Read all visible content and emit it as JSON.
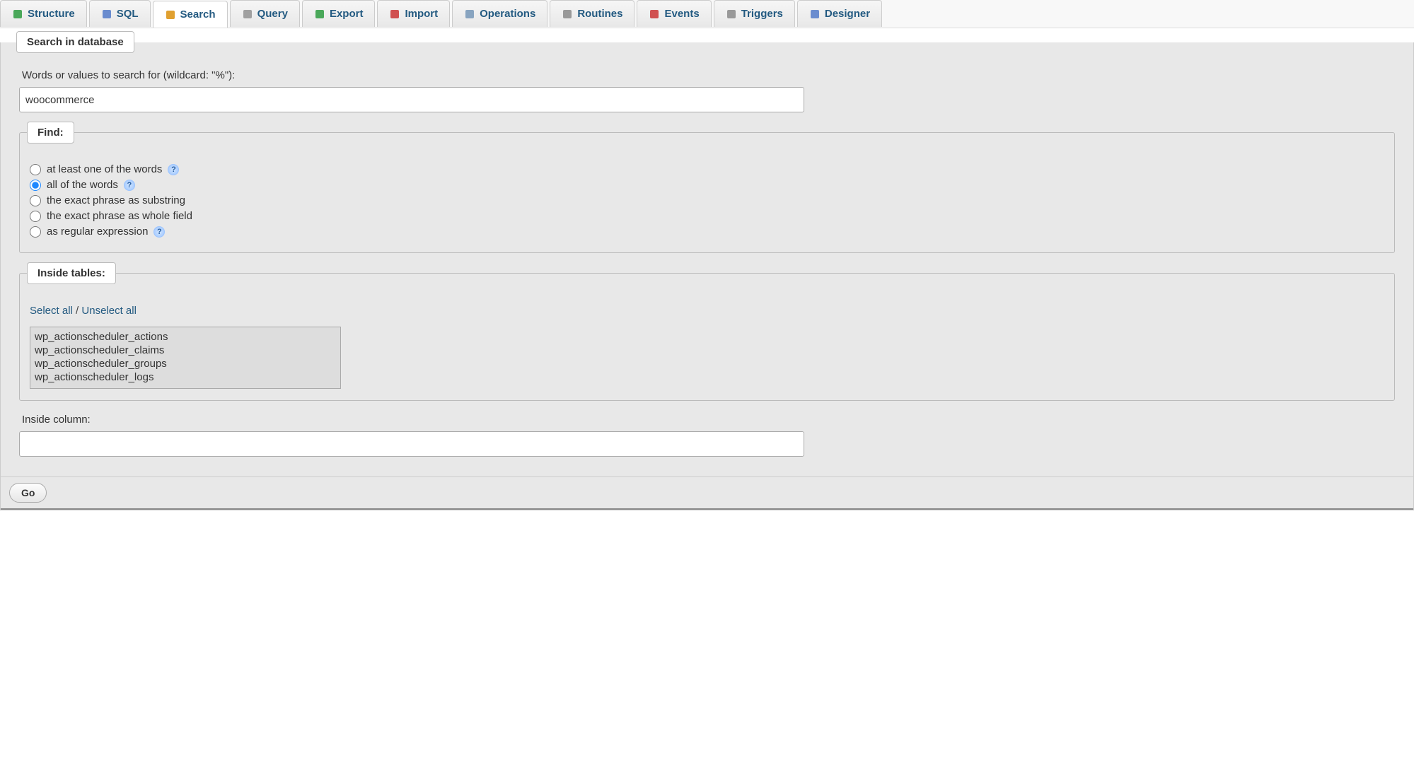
{
  "tabs": [
    {
      "label": "Structure",
      "icon": "structure-icon",
      "color": "#4aa85a"
    },
    {
      "label": "SQL",
      "icon": "sql-icon",
      "color": "#6a8ccf"
    },
    {
      "label": "Search",
      "icon": "search-icon",
      "color": "#e0a030",
      "active": true
    },
    {
      "label": "Query",
      "icon": "query-icon",
      "color": "#a0a0a0"
    },
    {
      "label": "Export",
      "icon": "export-icon",
      "color": "#4aa85a"
    },
    {
      "label": "Import",
      "icon": "import-icon",
      "color": "#d05050"
    },
    {
      "label": "Operations",
      "icon": "operations-icon",
      "color": "#88a4c0"
    },
    {
      "label": "Routines",
      "icon": "routines-icon",
      "color": "#999"
    },
    {
      "label": "Events",
      "icon": "events-icon",
      "color": "#d05050"
    },
    {
      "label": "Triggers",
      "icon": "triggers-icon",
      "color": "#999"
    },
    {
      "label": "Designer",
      "icon": "designer-icon",
      "color": "#6a8ccf"
    }
  ],
  "search_panel": {
    "legend": "Search in database",
    "words_label": "Words or values to search for (wildcard: \"%\"):",
    "words_value": "woocommerce",
    "find_legend": "Find:",
    "find_options": [
      {
        "label": "at least one of the words",
        "help": true,
        "checked": false
      },
      {
        "label": "all of the words",
        "help": true,
        "checked": true
      },
      {
        "label": "the exact phrase as substring",
        "help": false,
        "checked": false
      },
      {
        "label": "the exact phrase as whole field",
        "help": false,
        "checked": false
      },
      {
        "label": "as regular expression",
        "help": true,
        "checked": false
      }
    ],
    "tables_legend": "Inside tables:",
    "select_all": "Select all",
    "unselect_all": "Unselect all",
    "separator": " / ",
    "tables": [
      "wp_actionscheduler_actions",
      "wp_actionscheduler_claims",
      "wp_actionscheduler_groups",
      "wp_actionscheduler_logs"
    ],
    "inside_column_label": "Inside column:",
    "inside_column_value": ""
  },
  "go_label": "Go"
}
